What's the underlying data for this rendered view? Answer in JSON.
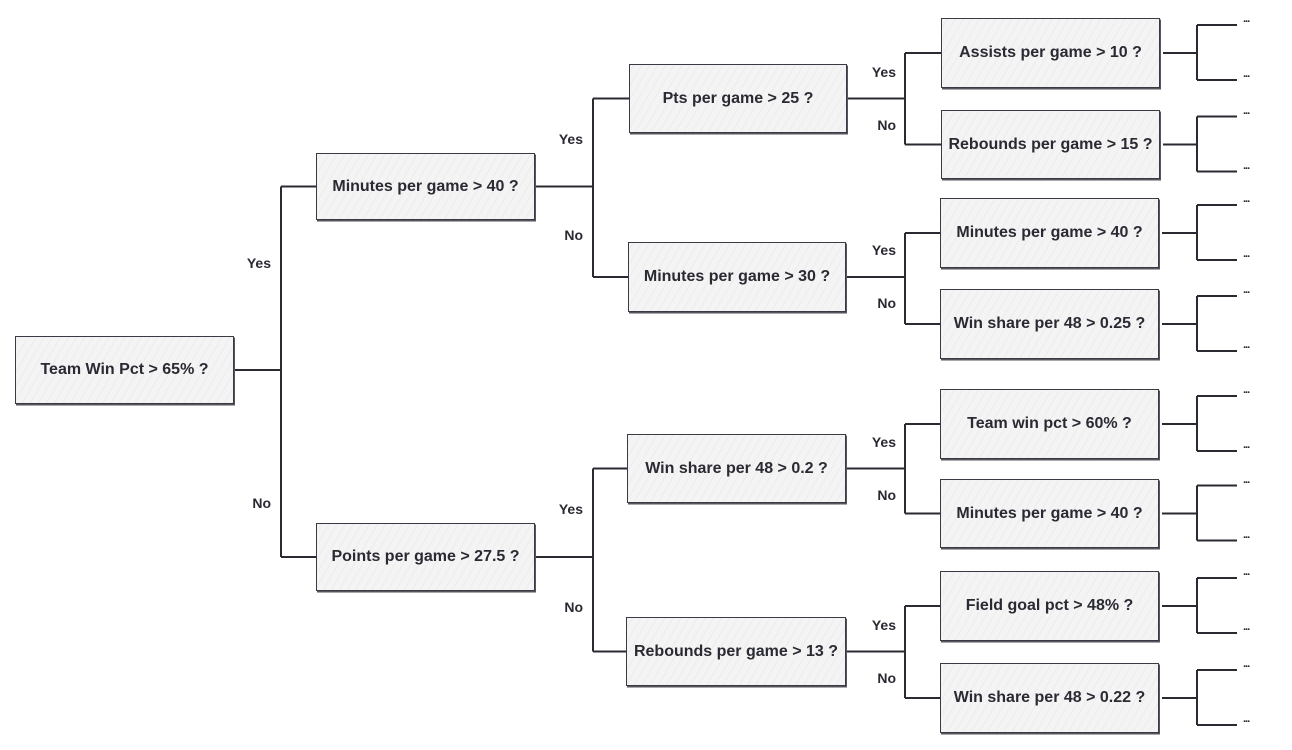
{
  "diagram": {
    "type": "decision-tree",
    "branch_labels": {
      "yes": "Yes",
      "no": "No"
    },
    "leaf_placeholder": "...",
    "root": {
      "id": "n0",
      "label": "Team Win Pct > 65% ?",
      "yes": {
        "id": "n1",
        "label": "Minutes per game > 40 ?",
        "yes": {
          "id": "n3",
          "label": "Pts per game > 25 ?",
          "yes": {
            "id": "n7",
            "label": "Assists per game > 10 ?"
          },
          "no": {
            "id": "n8",
            "label": "Rebounds per game > 15 ?"
          }
        },
        "no": {
          "id": "n4",
          "label": "Minutes per game > 30 ?",
          "yes": {
            "id": "n9",
            "label": "Minutes per game > 40 ?"
          },
          "no": {
            "id": "n10",
            "label": "Win share per 48 > 0.25 ?"
          }
        }
      },
      "no": {
        "id": "n2",
        "label": "Points per game > 27.5 ?",
        "yes": {
          "id": "n5",
          "label": "Win share per 48 > 0.2 ?",
          "yes": {
            "id": "n11",
            "label": "Team win pct > 60% ?"
          },
          "no": {
            "id": "n12",
            "label": "Minutes per game > 40 ?"
          }
        },
        "no": {
          "id": "n6",
          "label": "Rebounds per game > 13 ?",
          "yes": {
            "id": "n13",
            "label": "Field goal pct > 48% ?"
          },
          "no": {
            "id": "n14",
            "label": "Win share per 48 > 0.22 ?"
          }
        }
      }
    }
  }
}
